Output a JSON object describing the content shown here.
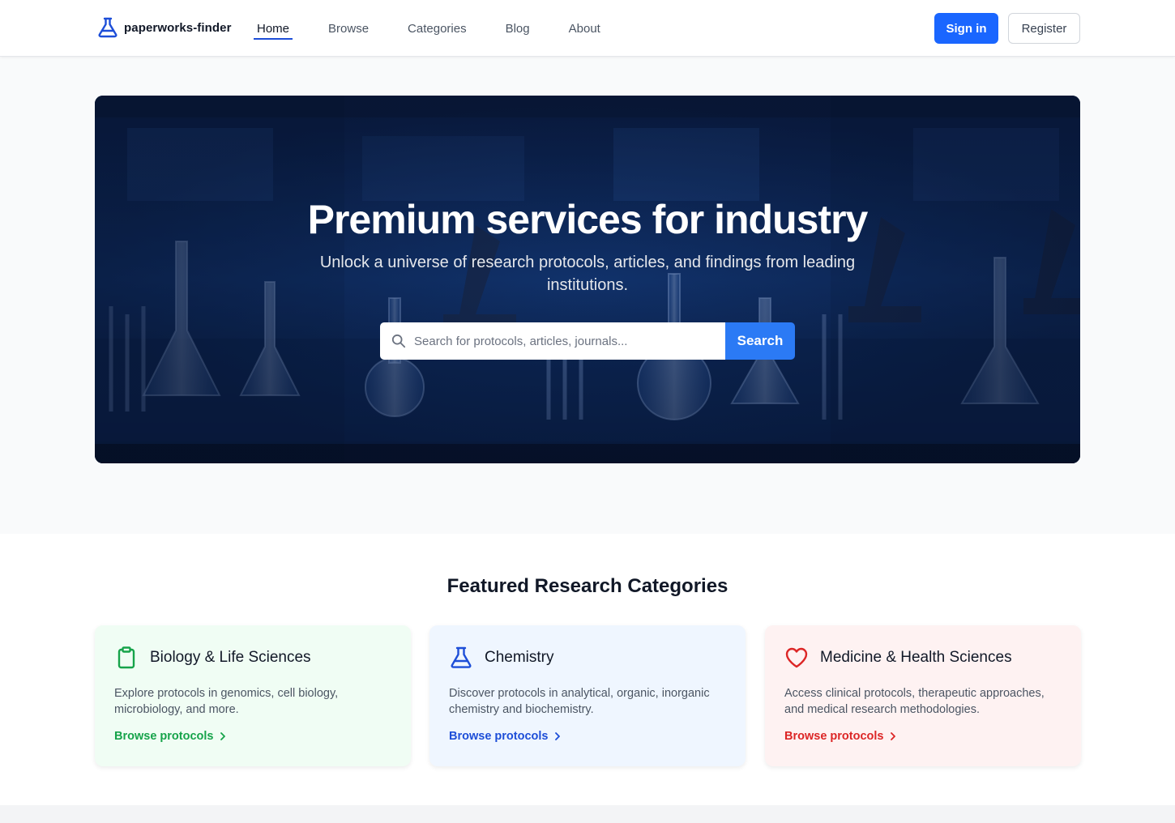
{
  "brand": {
    "name": "paperworks-finder",
    "icon": "flask-icon"
  },
  "nav": {
    "links": [
      {
        "label": "Home",
        "active": true
      },
      {
        "label": "Browse",
        "active": false
      },
      {
        "label": "Categories",
        "active": false
      },
      {
        "label": "Blog",
        "active": false
      },
      {
        "label": "About",
        "active": false
      }
    ],
    "sign_in": "Sign in",
    "register": "Register"
  },
  "hero": {
    "title": "Premium services for industry",
    "subtitle": "Unlock a universe of research protocols, articles, and findings from leading institutions.",
    "search_placeholder": "Search for protocols, articles, journals...",
    "search_button": "Search"
  },
  "featured": {
    "title": "Featured Research Categories",
    "cards": [
      {
        "title": "Biology & Life Sciences",
        "icon": "clipboard-icon",
        "description": "Explore protocols in genomics, cell biology, microbiology, and more.",
        "link": "Browse protocols",
        "color": "#16a34a"
      },
      {
        "title": "Chemistry",
        "icon": "flask-icon",
        "description": "Discover protocols in analytical, organic, inorganic chemistry and biochemistry.",
        "link": "Browse protocols",
        "color": "#1d4ed8"
      },
      {
        "title": "Medicine & Health Sciences",
        "icon": "heart-icon",
        "description": "Access clinical protocols, therapeutic approaches, and medical research methodologies.",
        "link": "Browse protocols",
        "color": "#dc2626"
      }
    ]
  },
  "colors": {
    "primary": "#1a66ff",
    "search_button": "#2b7af5"
  }
}
